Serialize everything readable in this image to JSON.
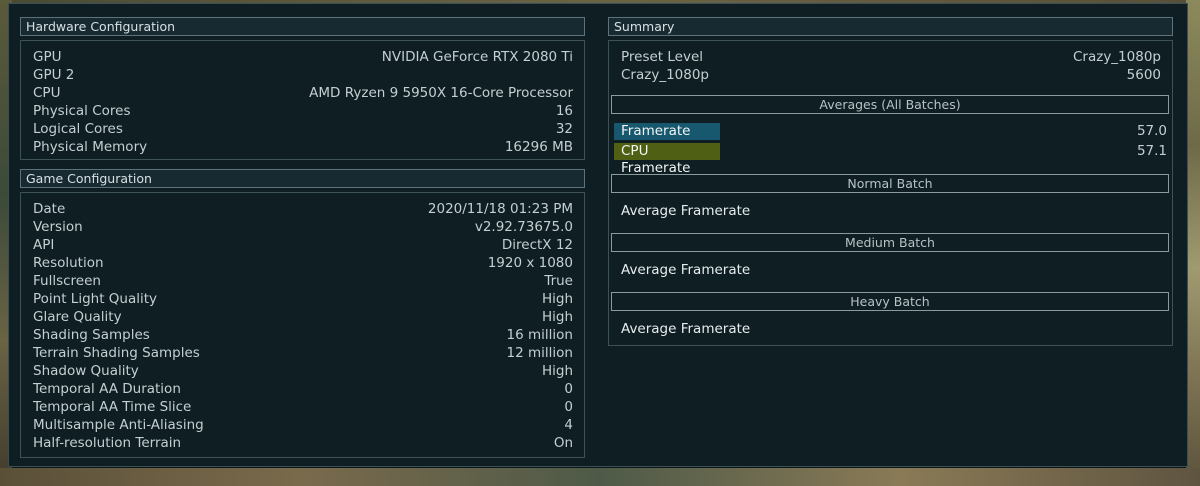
{
  "hardware": {
    "title": "Hardware Configuration",
    "rows": [
      {
        "key": "GPU",
        "value": "NVIDIA GeForce RTX 2080 Ti"
      },
      {
        "key": "GPU 2",
        "value": ""
      },
      {
        "key": "CPU",
        "value": "AMD Ryzen 9 5950X 16-Core Processor"
      },
      {
        "key": "Physical Cores",
        "value": "16"
      },
      {
        "key": "Logical Cores",
        "value": "32"
      },
      {
        "key": "Physical Memory",
        "value": "16296 MB"
      }
    ]
  },
  "game": {
    "title": "Game Configuration",
    "rows": [
      {
        "key": "Date",
        "value": "2020/11/18 01:23 PM"
      },
      {
        "key": "Version",
        "value": "v2.92.73675.0"
      },
      {
        "key": "API",
        "value": "DirectX 12"
      },
      {
        "key": "Resolution",
        "value": "1920 x 1080"
      },
      {
        "key": "Fullscreen",
        "value": "True"
      },
      {
        "key": "Point Light Quality",
        "value": "High"
      },
      {
        "key": "Glare Quality",
        "value": "High"
      },
      {
        "key": "Shading Samples",
        "value": "16 million"
      },
      {
        "key": "Terrain Shading Samples",
        "value": "12 million"
      },
      {
        "key": "Shadow Quality",
        "value": "High"
      },
      {
        "key": "Temporal AA Duration",
        "value": "0"
      },
      {
        "key": "Temporal AA Time Slice",
        "value": "0"
      },
      {
        "key": "Multisample Anti-Aliasing",
        "value": "4"
      },
      {
        "key": "Half-resolution Terrain",
        "value": "On"
      }
    ]
  },
  "summary": {
    "title": "Summary",
    "rows": [
      {
        "key": "Preset Level",
        "value": "Crazy_1080p"
      },
      {
        "key": "Crazy_1080p",
        "value": "5600"
      }
    ],
    "averages_header": "Averages (All Batches)",
    "framerate_label": "Framerate",
    "framerate_value": "57.0",
    "cpu_framerate_label": "CPU Framerate",
    "cpu_framerate_value": "57.1",
    "batches": [
      {
        "header": "Normal Batch",
        "label": "Average Framerate"
      },
      {
        "header": "Medium Batch",
        "label": "Average Framerate"
      },
      {
        "header": "Heavy Batch",
        "label": "Average Framerate"
      }
    ]
  },
  "colors": {
    "framerate_tag": "#17586e",
    "cpu_framerate_tag": "#4f5f14",
    "panel_bg": "#0f1e23"
  }
}
